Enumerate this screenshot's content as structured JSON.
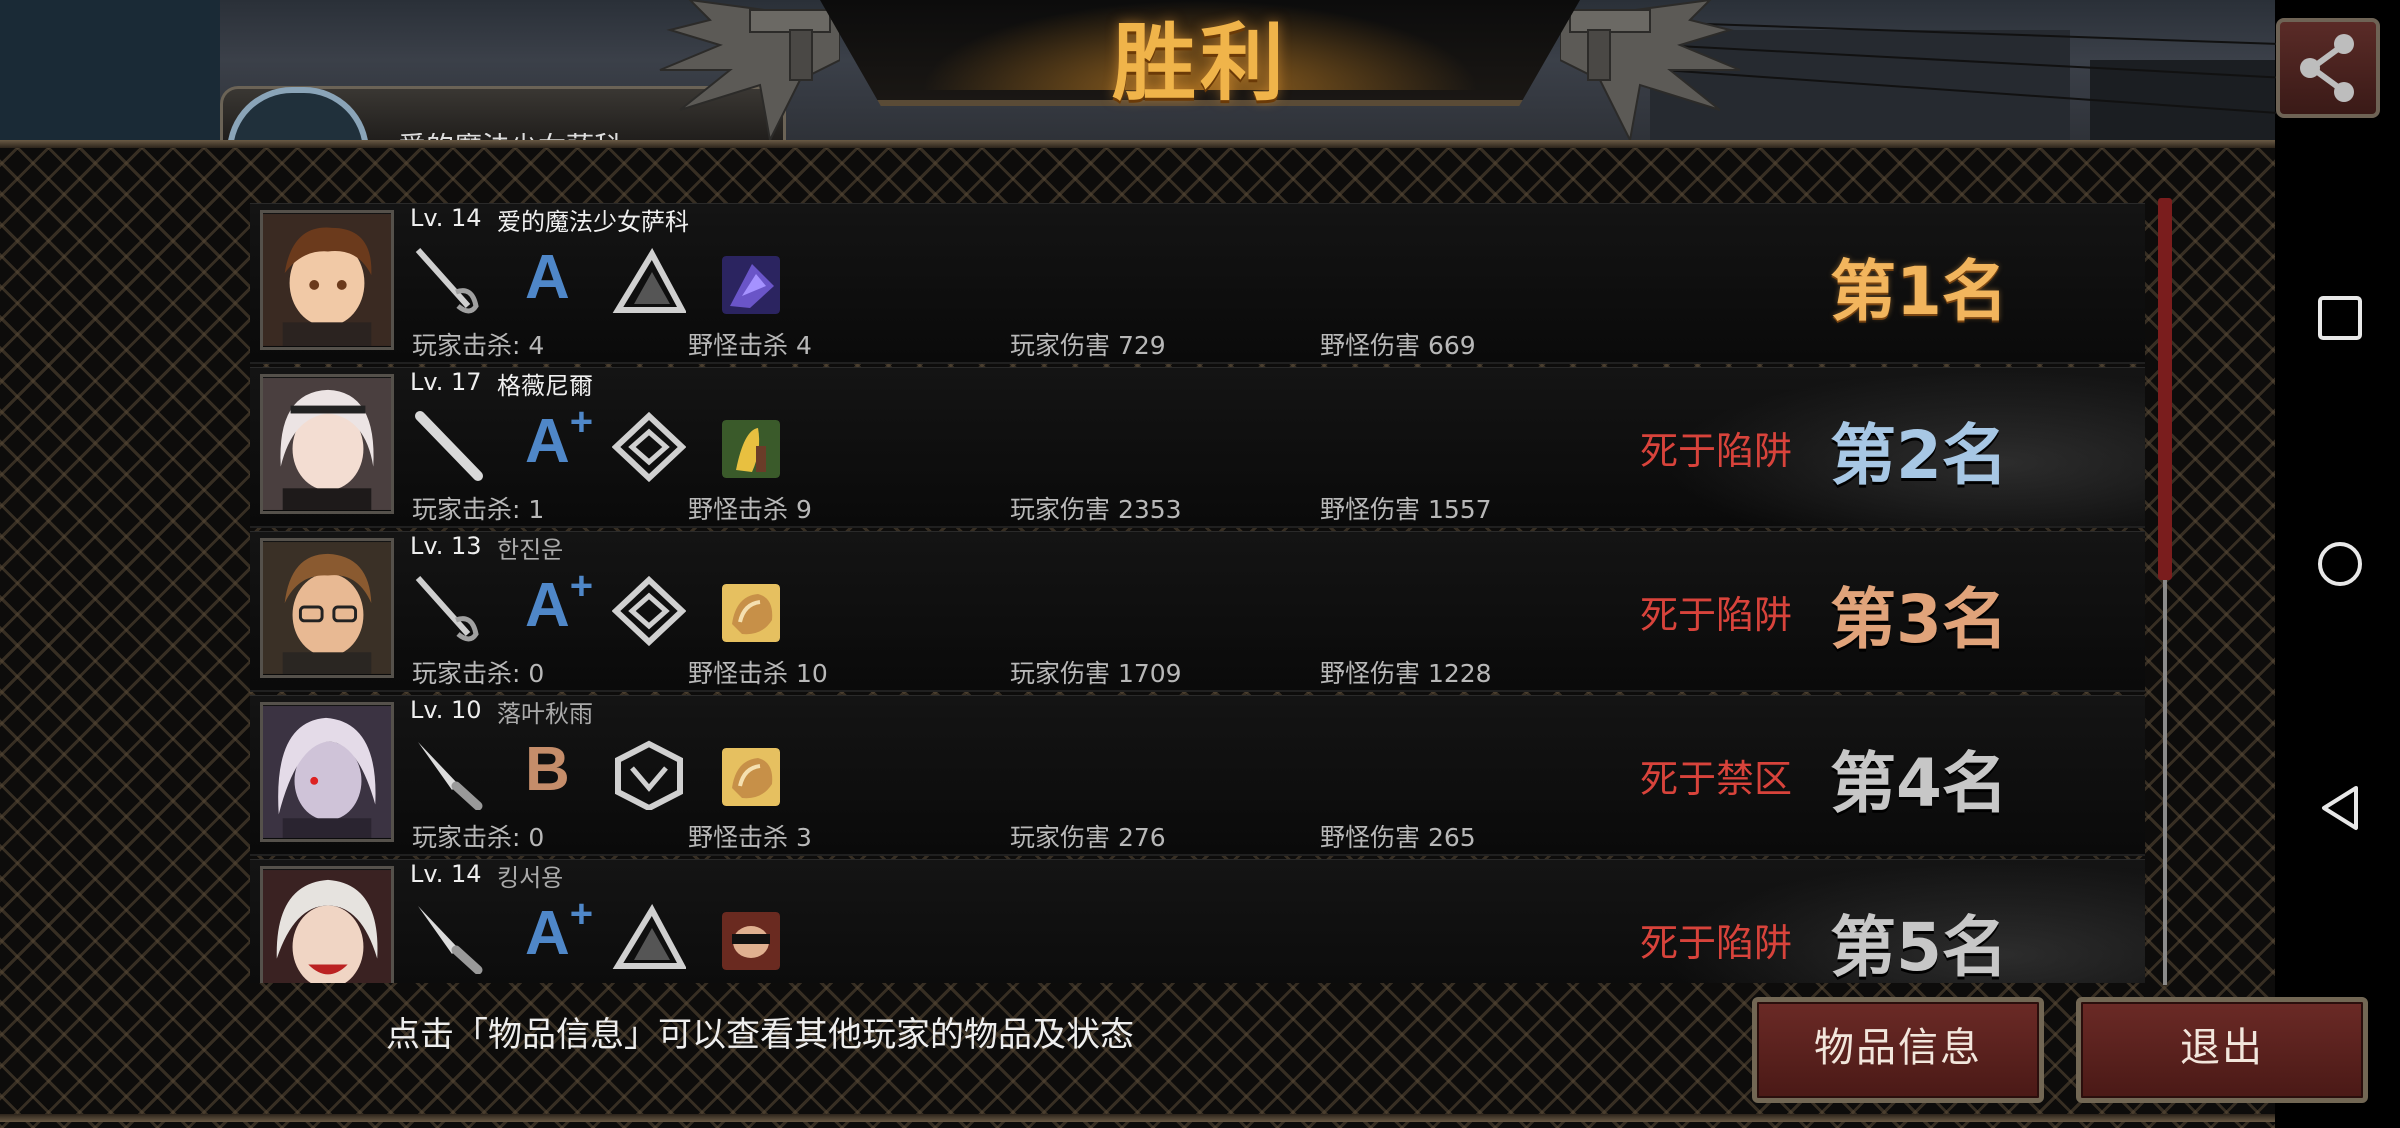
{
  "title": "胜利",
  "player_badge_name": "爱的魔法少女萨科",
  "players": [
    {
      "level": "Lv. 14",
      "name": "爱的魔法少女萨科",
      "grade": "A",
      "grade_plus": "",
      "player_kills": "玩家击杀: 4",
      "monster_kills": "野怪击杀 4",
      "player_damage": "玩家伤害 729",
      "monster_damage": "野怪伤害 669",
      "death": "",
      "rank": "第1名"
    },
    {
      "level": "Lv. 17",
      "name": "格薇尼爾",
      "grade": "A",
      "grade_plus": "+",
      "player_kills": "玩家击杀: 1",
      "monster_kills": "野怪击杀 9",
      "player_damage": "玩家伤害 2353",
      "monster_damage": "野怪伤害 1557",
      "death": "死于陷阱",
      "rank": "第2名"
    },
    {
      "level": "Lv. 13",
      "name": "한진운",
      "grade": "A",
      "grade_plus": "+",
      "player_kills": "玩家击杀: 0",
      "monster_kills": "野怪击杀 10",
      "player_damage": "玩家伤害 1709",
      "monster_damage": "野怪伤害 1228",
      "death": "死于陷阱",
      "rank": "第3名"
    },
    {
      "level": "Lv. 10",
      "name": "落叶秋雨",
      "grade": "B",
      "grade_plus": "",
      "player_kills": "玩家击杀: 0",
      "monster_kills": "野怪击杀 3",
      "player_damage": "玩家伤害 276",
      "monster_damage": "野怪伤害 265",
      "death": "死于禁区",
      "rank": "第4名"
    },
    {
      "level": "Lv. 14",
      "name": "킹서용",
      "grade": "A",
      "grade_plus": "+",
      "player_kills": "",
      "monster_kills": "",
      "player_damage": "",
      "monster_damage": "",
      "death": "死于陷阱",
      "rank": "第5名"
    }
  ],
  "hint": "点击「物品信息」可以查看其他玩家的物品及状态",
  "buttons": {
    "item_info": "物品信息",
    "exit": "退出"
  },
  "icons": {
    "share": "share-icon",
    "nav_recents": "square-icon",
    "nav_home": "circle-icon",
    "nav_back": "triangle-back-icon"
  },
  "colors": {
    "title": "#f0b44a",
    "death": "#d8433b",
    "grade_a": "#4f87c8",
    "grade_b": "#c58d6a",
    "button": "#5a211e"
  }
}
